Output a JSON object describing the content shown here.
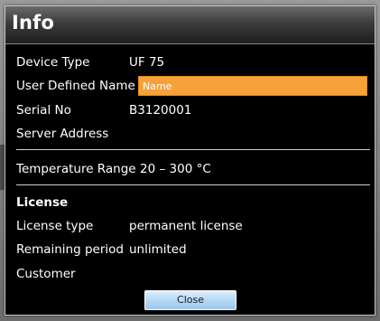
{
  "dialog": {
    "title": "Info"
  },
  "device": {
    "device_type_label": "Device Type",
    "device_type_value": "UF 75",
    "user_defined_name_label": "User Defined Name",
    "user_defined_name_value": "Name",
    "serial_no_label": "Serial No",
    "serial_no_value": "B3120001",
    "server_address_label": "Server Address",
    "server_address_value": ""
  },
  "temperature": {
    "label": "Temperature Range",
    "value": "20 – 300 °C"
  },
  "license": {
    "section_title": "License",
    "type_label": "License type",
    "type_value": "permanent license",
    "remaining_label": "Remaining period",
    "remaining_value": "unlimited",
    "customer_label": "Customer",
    "customer_value": ""
  },
  "buttons": {
    "close_label": "Close"
  },
  "colors": {
    "input_highlight": "#f5a23a",
    "dialog_background": "#000000",
    "button_blue": "#b7d8f5"
  }
}
